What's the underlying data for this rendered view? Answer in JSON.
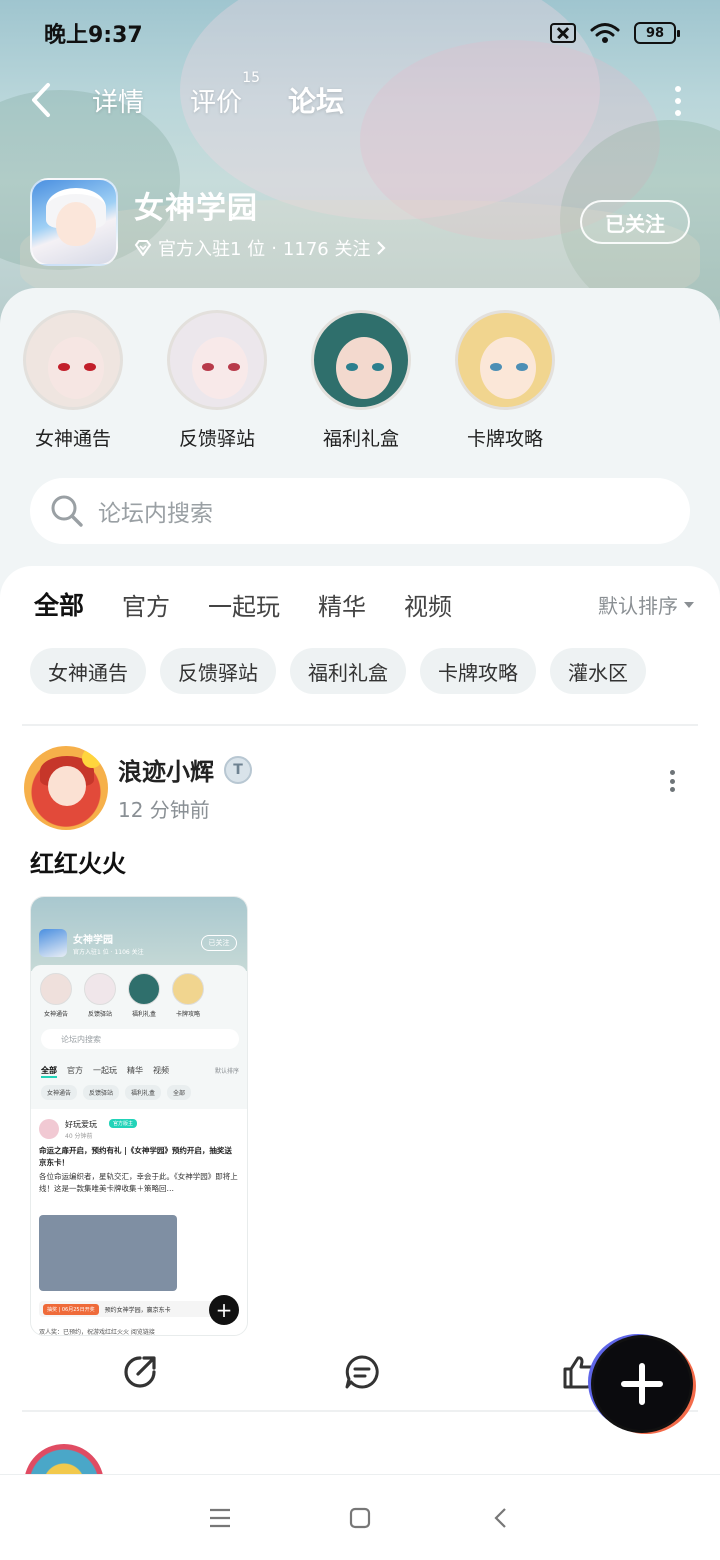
{
  "status_bar": {
    "time": "晚上9:37",
    "battery": "98"
  },
  "nav": {
    "tabs": [
      {
        "label": "详情"
      },
      {
        "label": "评价",
        "badge": "15"
      },
      {
        "label": "论坛"
      }
    ],
    "active_tab": "论坛"
  },
  "game": {
    "name": "女神学园",
    "official_count": "官方入驻1 位",
    "separator": "·",
    "followers": "1176 关注",
    "follow_button": "已关注"
  },
  "channels": [
    {
      "label": "女神通告"
    },
    {
      "label": "反馈驿站"
    },
    {
      "label": "福利礼盒"
    },
    {
      "label": "卡牌攻略"
    }
  ],
  "search": {
    "placeholder": "论坛内搜索"
  },
  "feed": {
    "tabs": [
      "全部",
      "官方",
      "一起玩",
      "精华",
      "视频"
    ],
    "sort_label": "默认排序",
    "chips": [
      "女神通告",
      "反馈驿站",
      "福利礼盒",
      "卡牌攻略",
      "灌水区"
    ]
  },
  "post": {
    "author": "浪迹小辉",
    "time": "12 分钟前",
    "title": "红红火火",
    "screenshot": {
      "game_name": "女神学园",
      "game_meta": "官方入驻1 位 · 1106 关注",
      "follow": "已关注",
      "channels": [
        "女神通告",
        "反馈驿站",
        "福利礼盒",
        "卡牌攻略"
      ],
      "search": "论坛内搜索",
      "tabs": [
        "全部",
        "官方",
        "一起玩",
        "精华",
        "视频"
      ],
      "sort": "默认排序",
      "chips": [
        "女神通告",
        "反馈驿站",
        "福利礼盒",
        "全部"
      ],
      "post_author": "好玩爱玩",
      "post_tag": "官方版主",
      "post_time": "40 分钟前",
      "post_headline": "命运之扉开启，预约有礼 |《女神学园》预约开启，抽奖送京东卡！",
      "post_body": "各位命运编织者，星轨交汇，幸会于此。《女神学园》即将上线！这是一款集唯美卡牌收集＋策略回…",
      "bar_tag": "抽奖 | 06月25日开奖",
      "bar_text": "预约女神学园，赢京东卡",
      "footer": "双人奖：已预约，祝游戏红红火火 阅览链接"
    }
  },
  "colors": {
    "accent": "#22d3b8",
    "panel_bg": "#f1f5f6"
  },
  "icons": {
    "back": "chevron-left-icon",
    "more": "more-vertical-icon",
    "search": "search-icon",
    "share": "share-icon",
    "comment": "comment-icon",
    "like": "thumbs-up-icon",
    "fab": "plus-icon"
  }
}
